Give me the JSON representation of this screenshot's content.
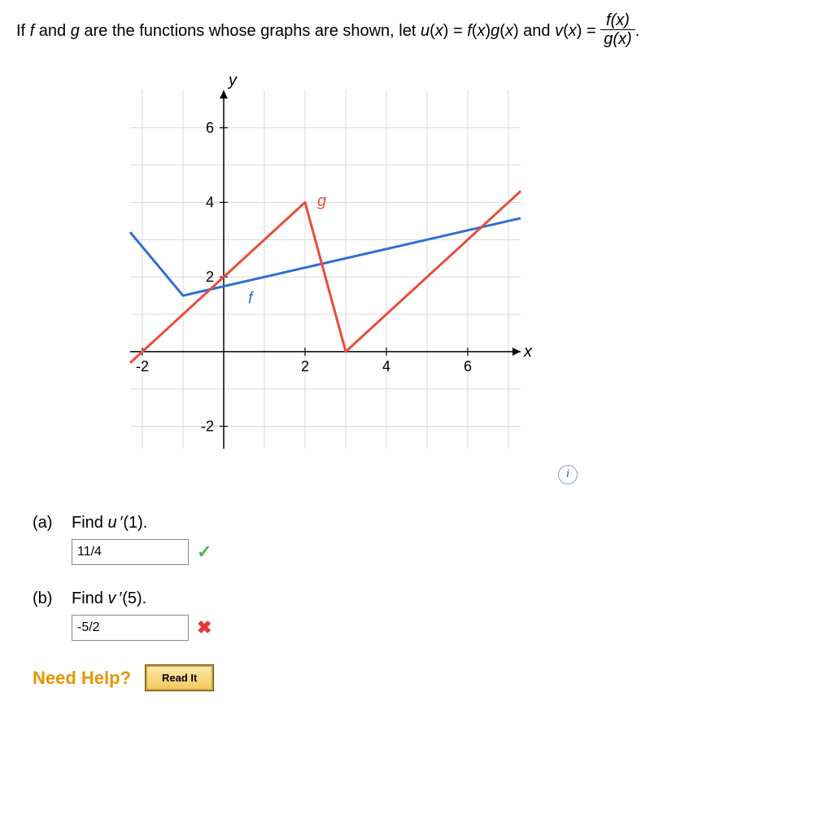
{
  "statement": {
    "prefix": "If ",
    "f": "f",
    "and": " and ",
    "g": "g",
    "mid1": " are the functions whose graphs are shown, let ",
    "u": "u",
    "expr1": "(",
    "xvar": "x",
    "expr2": ") = ",
    "fx": "f",
    "gx": "g",
    "mid2": " and ",
    "v": "v",
    "eq": ") = ",
    "frac_num_f": "f",
    "frac_num_x": "x",
    "frac_den_g": "g",
    "period": "."
  },
  "graph": {
    "y_label": "y",
    "x_label": "x",
    "f_label": "f",
    "g_label": "g",
    "x_ticks": [
      "-2",
      "2",
      "4",
      "6"
    ],
    "y_ticks": [
      "6",
      "4",
      "2",
      "-2"
    ],
    "x_tick_vals": [
      -2,
      2,
      4,
      6
    ],
    "y_tick_vals": [
      6,
      4,
      2,
      -2
    ]
  },
  "questions": {
    "a": {
      "label": "(a)",
      "prompt_pre": "Find ",
      "prompt_fn": "u",
      "prompt_post": "(1).",
      "answer": "11/4",
      "status": "correct"
    },
    "b": {
      "label": "(b)",
      "prompt_pre": "Find ",
      "prompt_fn": "v",
      "prompt_post": "(5).",
      "answer": "-5/2",
      "status": "incorrect"
    }
  },
  "need_help": {
    "label": "Need Help?",
    "button": "Read It"
  },
  "info_icon": "i",
  "chart_data": {
    "type": "line",
    "title": "",
    "xlabel": "x",
    "ylabel": "y",
    "xlim": [
      -2.3,
      7.3
    ],
    "ylim": [
      -2.6,
      7.0
    ],
    "x_ticks": [
      -2,
      2,
      4,
      6
    ],
    "y_ticks": [
      -2,
      2,
      4,
      6
    ],
    "series": [
      {
        "name": "f",
        "color": "#2d6fd1",
        "points": [
          [
            -2.3,
            3.2
          ],
          [
            -1,
            1.5
          ],
          [
            7.3,
            3.575
          ]
        ]
      },
      {
        "name": "g",
        "color": "#e84d3c",
        "points": [
          [
            -2.3,
            -0.3
          ],
          [
            2,
            4
          ],
          [
            3,
            0
          ],
          [
            7.3,
            4.3
          ]
        ]
      }
    ]
  }
}
